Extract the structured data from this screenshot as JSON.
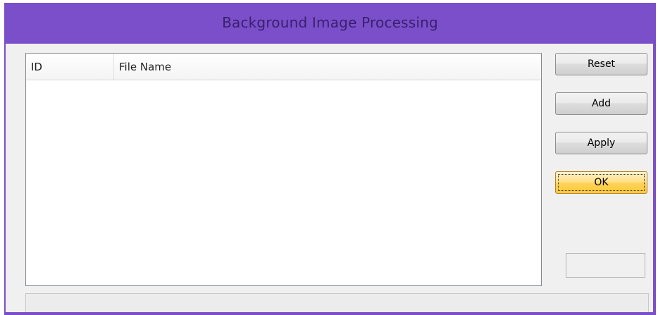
{
  "window": {
    "title": "Background Image Processing"
  },
  "listview": {
    "columns": [
      "ID",
      "File Name"
    ],
    "rows": []
  },
  "buttons": {
    "reset": "Reset",
    "add": "Add",
    "apply": "Apply",
    "ok": "OK"
  },
  "colors": {
    "frame": "#7b4fc9",
    "title_text": "#3a1f6e",
    "client_bg": "#f0f0f0",
    "ok_button": "#ffd257"
  }
}
